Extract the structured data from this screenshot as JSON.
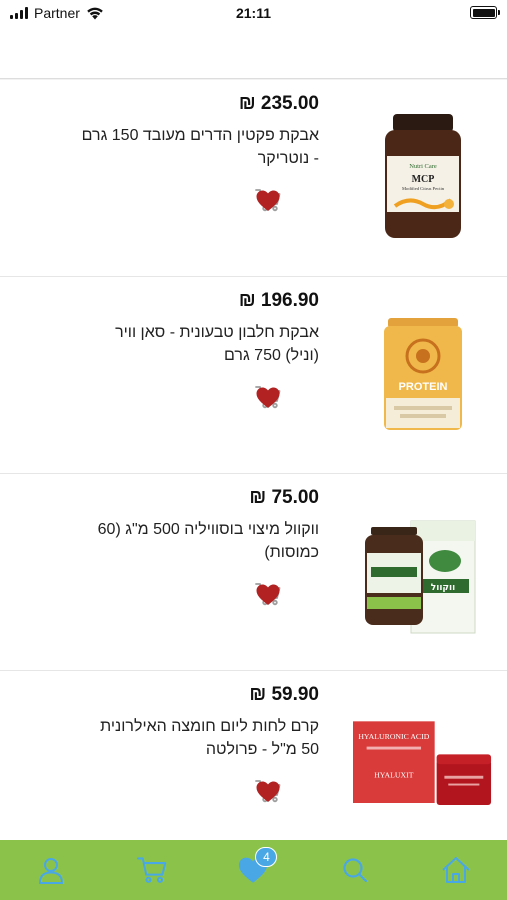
{
  "status_bar": {
    "carrier": "Partner",
    "time": "21:11",
    "battery_level": 1.0
  },
  "products": [
    {
      "price": "₪ 235.00",
      "name": "אבקת פקטין הדרים מעובד 150 גרם - נוטריקר",
      "image": "jar-mcp",
      "label_brand": "Nutri Care",
      "label_title": "MCP",
      "label_sub": "Modified Citrus Pectin"
    },
    {
      "price": "₪ 196.90",
      "name": "אבקת חלבון טבעונית - סאן וויר (וניל) 750 גרם",
      "image": "jar-protein",
      "label_title": "PROTEIN"
    },
    {
      "price": "₪ 75.00",
      "name": "ווקוול מיצוי בוסוויליה 500 מ\"ג (60 כמוסות)",
      "image": "box-vokol",
      "label_title": "ווקוול"
    },
    {
      "price": "₪ 59.90",
      "name": "קרם לחות ליום חומצה האילרונית 50 מ\"ל - פרולטה",
      "image": "box-hyaluronic",
      "label_title": "HYALURONIC ACID",
      "label_sub": "HYALUXIT"
    }
  ],
  "icons": {
    "heart": "heart-icon",
    "cart": "cart-icon"
  },
  "colors": {
    "heart": "#b22222",
    "cart": "#9e9e9e",
    "tabbar_bg": "#8bc34a",
    "tab_icon": "#4aa7e6"
  },
  "tabbar": {
    "tabs": [
      "profile",
      "cart",
      "favorites",
      "search",
      "home"
    ],
    "favorites_badge": "4"
  }
}
